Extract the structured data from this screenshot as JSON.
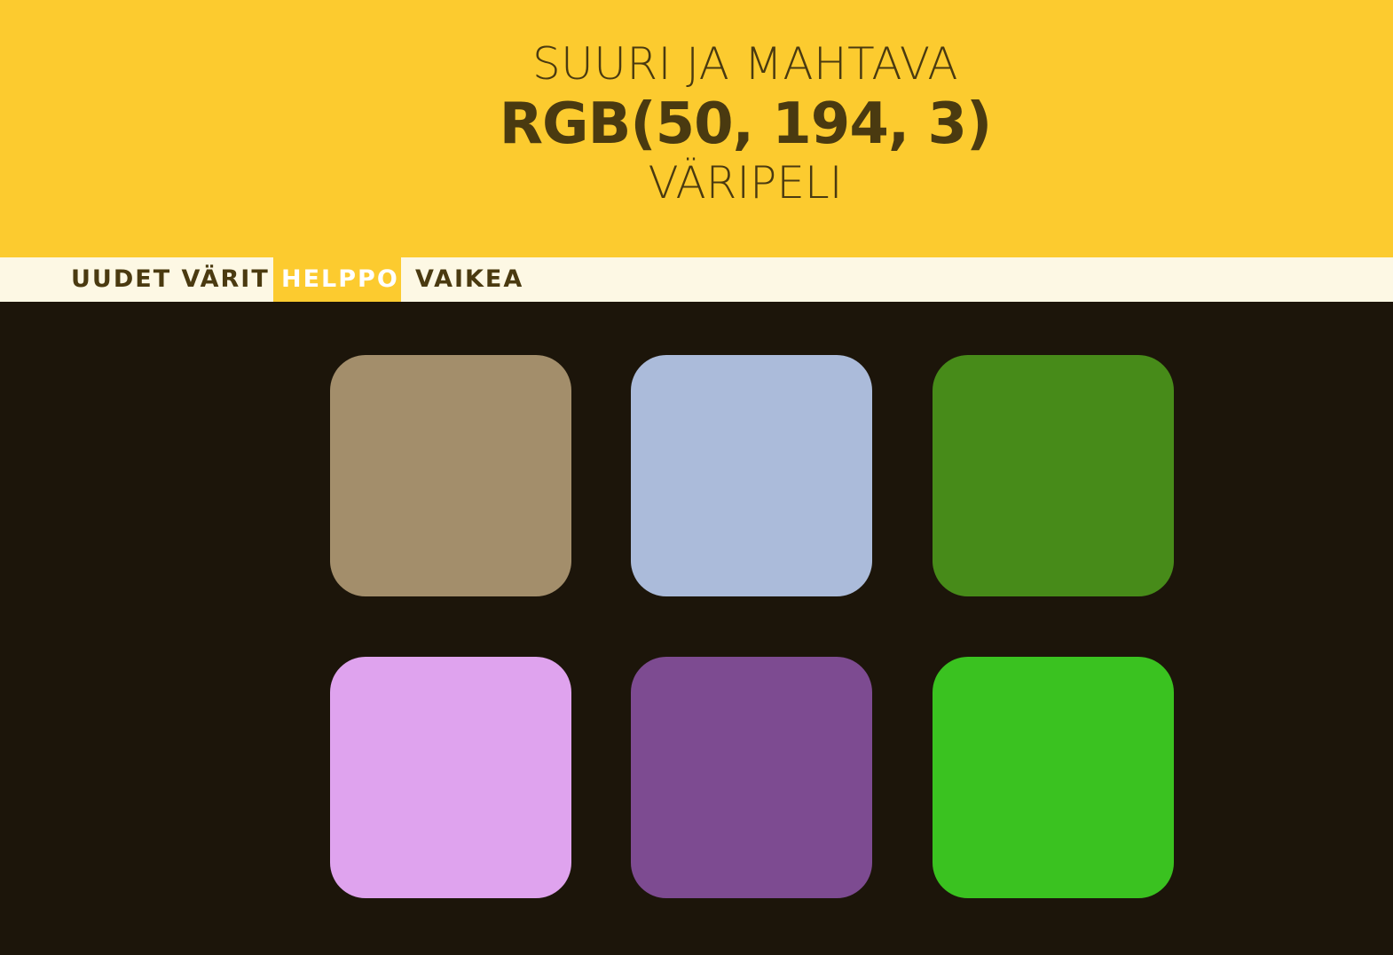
{
  "header": {
    "subtitle": "SUURI JA MAHTAVA",
    "target_color": "RGB(50, 194, 3)",
    "title": "VÄRIPELI",
    "background": "#fccb2f",
    "text_color": "#4a3a10"
  },
  "nav": {
    "new_colors_label": "UUDET VÄRIT",
    "easy_label": "HELPPO",
    "hard_label": "VAIKEA",
    "selected_mode": "HELPPO"
  },
  "board": {
    "background": "#1c150a",
    "tiles": [
      {
        "color": "#a38e6b"
      },
      {
        "color": "#abbbda"
      },
      {
        "color": "#478b19"
      },
      {
        "color": "#dfa3ee"
      },
      {
        "color": "#7d4b91"
      },
      {
        "color": "#3ac220"
      }
    ]
  }
}
